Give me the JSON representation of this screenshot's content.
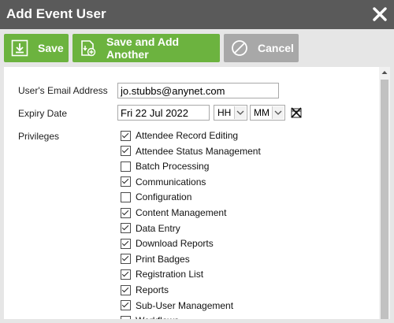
{
  "dialog": {
    "title": "Add Event User"
  },
  "toolbar": {
    "save_label": "Save",
    "save_add_label": "Save and Add Another",
    "cancel_label": "Cancel"
  },
  "form": {
    "email_label": "User's Email Address",
    "email_value": "jo.stubbs@anynet.com",
    "expiry_label": "Expiry Date",
    "expiry_value": "Fri 22 Jul 2022",
    "hour_value": "HH",
    "minute_value": "MM",
    "privileges_label": "Privileges",
    "privileges": [
      {
        "label": "Attendee Record Editing",
        "checked": true
      },
      {
        "label": "Attendee Status Management",
        "checked": true
      },
      {
        "label": "Batch Processing",
        "checked": false
      },
      {
        "label": "Communications",
        "checked": true
      },
      {
        "label": "Configuration",
        "checked": false
      },
      {
        "label": "Content Management",
        "checked": true
      },
      {
        "label": "Data Entry",
        "checked": true
      },
      {
        "label": "Download Reports",
        "checked": true
      },
      {
        "label": "Print Badges",
        "checked": true
      },
      {
        "label": "Registration List",
        "checked": true
      },
      {
        "label": "Reports",
        "checked": true
      },
      {
        "label": "Sub-User Management",
        "checked": true
      },
      {
        "label": "Workflows",
        "checked": false
      }
    ]
  },
  "colors": {
    "titlebar": "#5a5a5a",
    "green": "#6cb33f",
    "gray": "#a8a8a8"
  }
}
